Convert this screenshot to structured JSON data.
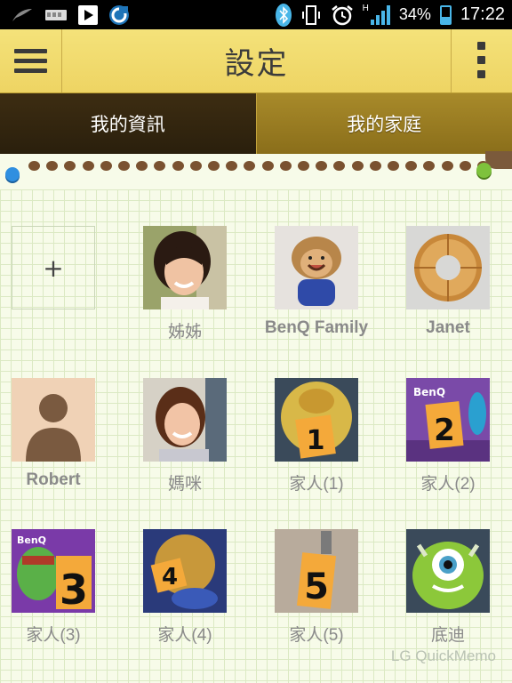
{
  "status_bar": {
    "battery_percent": "34%",
    "time": "17:22",
    "network": "H",
    "icons": [
      "feather-icon",
      "sd-card-icon",
      "play-icon",
      "sync-app-icon",
      "bluetooth-icon",
      "vibrate-icon",
      "alarm-icon",
      "signal-icon",
      "battery-icon"
    ]
  },
  "action_bar": {
    "title": "設定",
    "menu_icon": "hamburger-icon",
    "overflow_icon": "more-vertical-icon"
  },
  "tabs": [
    {
      "label": "我的資訊",
      "selected": false
    },
    {
      "label": "我的家庭",
      "selected": true
    }
  ],
  "add_button_label": "+",
  "members": [
    {
      "name": "姊姊",
      "photo": "girl-portrait"
    },
    {
      "name": "BenQ Family",
      "photo": "lion-mascot"
    },
    {
      "name": "Janet",
      "photo": "ring-cake"
    },
    {
      "name": "Robert",
      "photo": "default-avatar"
    },
    {
      "name": "媽咪",
      "photo": "woman-portrait"
    },
    {
      "name": "家人(1)",
      "photo": "lion-card-1",
      "digit": "1"
    },
    {
      "name": "家人(2)",
      "photo": "card-2",
      "digit": "2"
    },
    {
      "name": "家人(3)",
      "photo": "bird-card-3",
      "digit": "3"
    },
    {
      "name": "家人(4)",
      "photo": "lion-card-4",
      "digit": "4"
    },
    {
      "name": "家人(5)",
      "photo": "card-5",
      "digit": "5"
    },
    {
      "name": "底迪",
      "photo": "green-monster"
    }
  ],
  "watermark": "LG QuickMemo",
  "colors": {
    "accent_yellow": "#eed463",
    "tab_dark": "#2a1f0c",
    "tab_gold": "#9a7c22",
    "status_blue": "#49b6e8",
    "label_gray": "#8a8a8a"
  }
}
